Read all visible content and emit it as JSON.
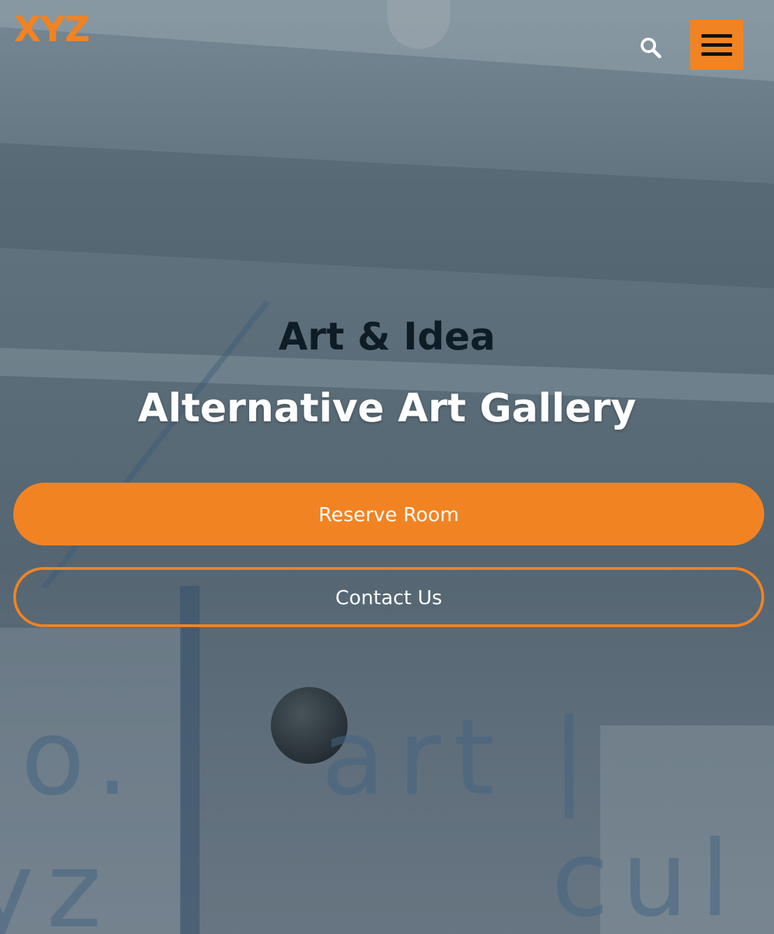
{
  "header": {
    "logo_text": "XYZ",
    "search_icon": "search-icon",
    "menu_icon": "hamburger-menu-icon"
  },
  "hero": {
    "kicker": "Art & Idea",
    "title": "Alternative Art Gallery",
    "primary_button_label": "Reserve Room",
    "secondary_button_label": "Contact Us"
  },
  "colors": {
    "accent": "#f28322",
    "kicker_text": "#0e1c26",
    "title_text": "#ffffff"
  }
}
